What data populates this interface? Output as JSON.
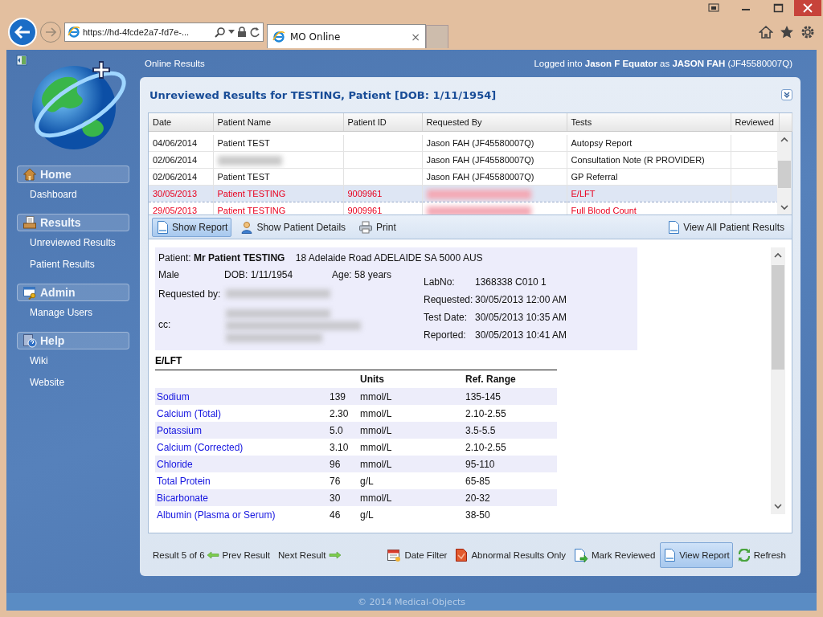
{
  "browser": {
    "address": "https://hd-4fcde2a7-fd7e-...",
    "tab_title": "MO Online",
    "tab_close": "×"
  },
  "header": {
    "section": "Online Results",
    "login": "Logged into **Jason F Equator** as **JASON FAH** (JF45580007Q)"
  },
  "sidebar": {
    "groups": [
      {
        "title": "Home",
        "items": [
          "Dashboard"
        ]
      },
      {
        "title": "Results",
        "items": [
          "Unreviewed Results",
          "Patient Results"
        ]
      },
      {
        "title": "Admin",
        "items": [
          "Manage Users"
        ]
      },
      {
        "title": "Help",
        "items": [
          "Wiki",
          "Website"
        ]
      }
    ]
  },
  "panel": {
    "title": "Unreviewed Results for TESTING, Patient [DOB: 1/11/1954]",
    "table": {
      "columns": [
        "Date",
        "Patient Name",
        "Patient ID",
        "Requested By",
        "Tests",
        "Reviewed"
      ],
      "rows": [
        {
          "cells": [
            "04/06/2014",
            "Patient TEST",
            null,
            "Jason FAH (JF45580007Q)",
            "Autopsy Report",
            null
          ],
          "abnormal": false,
          "selected": false
        },
        {
          "cells": [
            "02/06/2014",
            {
              "redacted": true
            },
            null,
            "Jason FAH (JF45580007Q)",
            "Consultation Note (R PROVIDER)",
            null
          ],
          "abnormal": false,
          "selected": false
        },
        {
          "cells": [
            "02/06/2014",
            "Patient TEST",
            null,
            "Jason FAH (JF45580007Q)",
            "GP Referral",
            null
          ],
          "abnormal": false,
          "selected": false
        },
        {
          "cells": [
            "30/05/2013",
            "Patient TESTING",
            "9009961",
            {
              "redacted": true
            },
            "E/LFT",
            null
          ],
          "abnormal": true,
          "selected": true
        },
        {
          "cells": [
            "29/05/2013",
            "Patient TESTING",
            "9009961",
            {
              "redacted": true
            },
            "Full Blood Count",
            null
          ],
          "abnormal": true,
          "selected": false
        }
      ]
    },
    "toolbar": {
      "left": [
        {
          "label": "Show Report",
          "selected": true
        },
        {
          "label": "Show Patient Details",
          "selected": false
        },
        {
          "label": "Print",
          "selected": false
        }
      ],
      "right": [
        {
          "label": "View All Patient Results",
          "selected": false
        }
      ]
    },
    "report": {
      "patient_label": "Patient:",
      "patient_name": "Mr Patient TESTING",
      "address": "18 Adelaide Road ADELAIDE SA 5000 AUS",
      "sex": "Male",
      "dob": "DOB: 1/11/1954",
      "age": "Age: 58 years",
      "requested_by_label": "Requested by:",
      "cc_label": "cc:",
      "lab_fields": [
        {
          "label": "LabNo:",
          "value": "1368338 C010 1"
        },
        {
          "label": "Requested:",
          "value": "30/05/2013 12:00 AM"
        },
        {
          "label": "Test Date:",
          "value": "30/05/2013 10:35 AM"
        },
        {
          "label": "Reported:",
          "value": "30/05/2013 10:41 AM"
        }
      ],
      "section": "E/LFT",
      "columns": [
        "Units",
        "Ref. Range"
      ],
      "results": [
        {
          "test": "Sodium",
          "value": "139",
          "units": "mmol/L",
          "range": "135-145"
        },
        {
          "test": "Calcium (Total)",
          "value": "2.30",
          "units": "mmol/L",
          "range": "2.10-2.55"
        },
        {
          "test": "Potassium",
          "value": "5.0",
          "units": "mmol/L",
          "range": "3.5-5.5"
        },
        {
          "test": "Calcium (Corrected)",
          "value": "3.10",
          "units": "mmol/L",
          "range": "2.10-2.55"
        },
        {
          "test": "Chloride",
          "value": "96",
          "units": "mmol/L",
          "range": "95-110"
        },
        {
          "test": "Total Protein",
          "value": "76",
          "units": "g/L",
          "range": "65-85"
        },
        {
          "test": "Bicarbonate",
          "value": "30",
          "units": "mmol/L",
          "range": "20-32"
        },
        {
          "test": "Albumin (Plasma or Serum)",
          "value": "46",
          "units": "g/L",
          "range": "38-50"
        }
      ]
    },
    "bottom_bar": {
      "counter": "Result 5 of 6",
      "prev": "Prev Result",
      "next": "Next Result",
      "actions": [
        {
          "label": "Date Filter",
          "selected": false
        },
        {
          "label": "Abnormal Results Only",
          "selected": false
        },
        {
          "label": "Mark Reviewed",
          "selected": false
        },
        {
          "label": "View Report",
          "selected": true
        },
        {
          "label": "Refresh",
          "selected": false
        }
      ]
    }
  },
  "footer": {
    "copyright": "© 2014 Medical-Objects"
  }
}
